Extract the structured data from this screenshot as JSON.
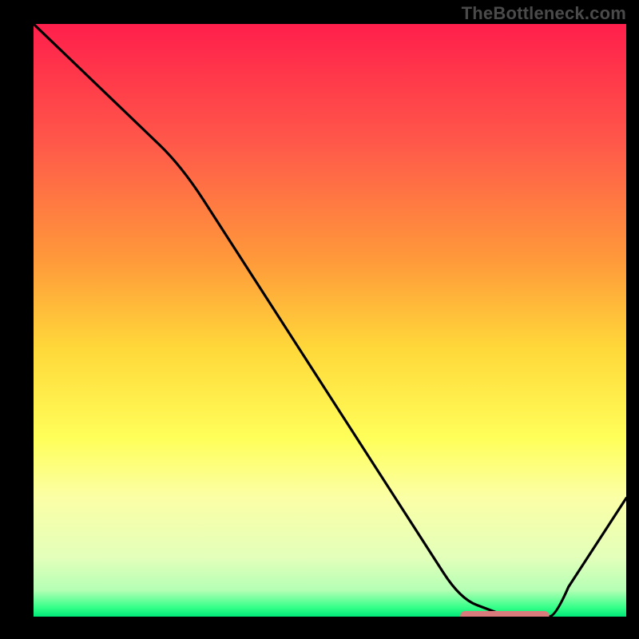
{
  "watermark": "TheBottleneck.com",
  "colors": {
    "background": "#000000",
    "watermark_text": "#4a4a4a",
    "curve": "#000000",
    "marker": "#d97a7c",
    "gradient_stops": [
      {
        "offset": 0.0,
        "color": "#ff1f4b"
      },
      {
        "offset": 0.2,
        "color": "#ff584a"
      },
      {
        "offset": 0.4,
        "color": "#ff9a3a"
      },
      {
        "offset": 0.55,
        "color": "#ffd93a"
      },
      {
        "offset": 0.7,
        "color": "#ffff5a"
      },
      {
        "offset": 0.8,
        "color": "#fbffa6"
      },
      {
        "offset": 0.9,
        "color": "#e3ffba"
      },
      {
        "offset": 0.955,
        "color": "#b5ffb5"
      },
      {
        "offset": 0.985,
        "color": "#33ff88"
      },
      {
        "offset": 1.0,
        "color": "#00e878"
      }
    ]
  },
  "chart_data": {
    "type": "line",
    "title": "",
    "xlabel": "",
    "ylabel": "",
    "xlim": [
      0,
      100
    ],
    "ylim": [
      0,
      100
    ],
    "series": [
      {
        "name": "bottleneck-curve",
        "x": [
          0,
          25,
          72,
          80,
          87,
          100
        ],
        "y": [
          100,
          76,
          3,
          0,
          0,
          20
        ],
        "segments": [
          "line",
          "line",
          "line",
          "line",
          "line",
          "line"
        ]
      }
    ],
    "marker": {
      "name": "optimal-range",
      "x_start": 72,
      "x_end": 87,
      "y": 0,
      "color": "#d97a7c"
    },
    "gradient_axis": "y",
    "gradient_meaning": "red=high bottleneck, green=low bottleneck"
  }
}
